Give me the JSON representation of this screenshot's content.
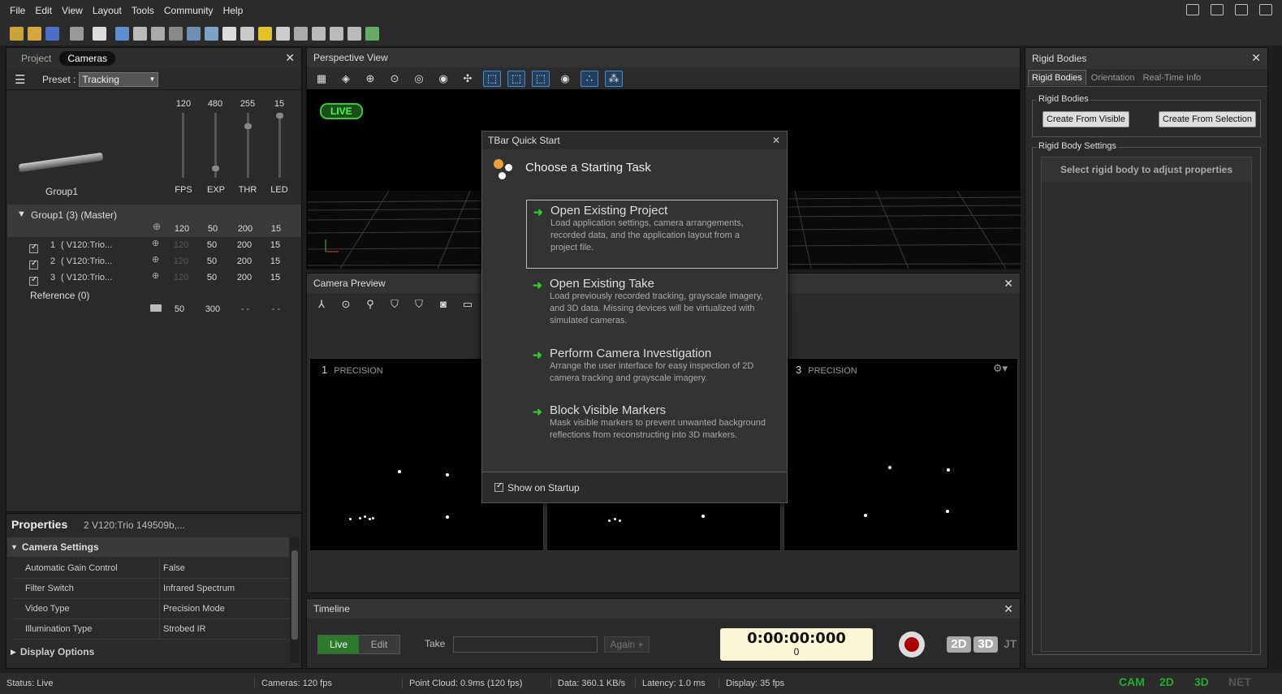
{
  "menu": [
    "File",
    "Edit",
    "View",
    "Layout",
    "Tools",
    "Community",
    "Help"
  ],
  "left_panel": {
    "tabs": [
      "Project",
      "Cameras"
    ],
    "preset_label": "Preset :",
    "preset_value": "Tracking",
    "group_thumb_label": "Group1",
    "slider_values": [
      "120",
      "480",
      "255",
      "15"
    ],
    "slider_labels": [
      "FPS",
      "EXP",
      "THR",
      "LED"
    ],
    "group_row": {
      "name": "Group1 (3) (Master)",
      "fps": "120",
      "exp": "50",
      "thr": "200",
      "led": "15"
    },
    "cameras": [
      {
        "idx": "1",
        "name": "( V120:Trio...",
        "fps": "120",
        "exp": "50",
        "thr": "200",
        "led": "15"
      },
      {
        "idx": "2",
        "name": "( V120:Trio...",
        "fps": "120",
        "exp": "50",
        "thr": "200",
        "led": "15"
      },
      {
        "idx": "3",
        "name": "( V120:Trio...",
        "fps": "120",
        "exp": "50",
        "thr": "200",
        "led": "15"
      }
    ],
    "reference": {
      "name": "Reference (0)",
      "exp": "50",
      "thr": "300",
      "a": "- -",
      "b": "- -"
    }
  },
  "properties": {
    "title": "Properties",
    "subtitle": "2 V120:Trio 149509b,...",
    "section1": "Camera Settings",
    "rows": [
      {
        "k": "Automatic Gain Control",
        "v": "False"
      },
      {
        "k": "Filter Switch",
        "v": "Infrared Spectrum"
      },
      {
        "k": "Video Type",
        "v": "Precision Mode"
      },
      {
        "k": "Illumination Type",
        "v": "Strobed IR"
      }
    ],
    "section2": "Display Options"
  },
  "perspective": {
    "title": "Perspective View",
    "live": "LIVE"
  },
  "camera_preview": {
    "title": "Camera Preview",
    "feeds": [
      {
        "num": "1",
        "mode": "PRECISION"
      },
      {
        "num": "3",
        "mode": "PRECISION"
      }
    ]
  },
  "timeline": {
    "title": "Timeline",
    "live": "Live",
    "edit": "Edit",
    "take_label": "Take",
    "again": "Again +",
    "time": "0:00:00:000",
    "frame": "0",
    "b2d": "2D",
    "b3d": "3D",
    "jt": "JT"
  },
  "rigid": {
    "title": "Rigid Bodies",
    "tabs": [
      "Rigid Bodies",
      "Orientation",
      "Real-Time Info"
    ],
    "group1": "Rigid Bodies",
    "btn1": "Create From Visible",
    "btn2": "Create From Selection",
    "group2": "Rigid Body Settings",
    "hint": "Select rigid body to adjust properties"
  },
  "dialog": {
    "title": "TBar Quick Start",
    "heading": "Choose a Starting Task",
    "tasks": [
      {
        "t": "Open Existing Project",
        "d": "Load application settings, camera arrangements, recorded data, and the application layout from a project file."
      },
      {
        "t": "Open Existing Take",
        "d": "Load previously recorded tracking, grayscale imagery, and 3D data.  Missing devices will be virtualized with simulated cameras."
      },
      {
        "t": "Perform Camera Investigation",
        "d": "Arrange the user interface for easy inspection of 2D camera tracking and grayscale imagery."
      },
      {
        "t": "Block Visible Markers",
        "d": "Mask visible markers to prevent unwanted background reflections from reconstructing into 3D markers."
      }
    ],
    "startup": "Show on Startup"
  },
  "status": {
    "items": [
      "Status: Live",
      "Cameras: 120 fps",
      "Point Cloud: 0.9ms (120 fps)",
      "Data: 360.1 KB/s",
      "Latency: 1.0 ms",
      "Display: 35 fps"
    ],
    "modes": [
      "CAM",
      "2D",
      "3D",
      "NET"
    ]
  }
}
